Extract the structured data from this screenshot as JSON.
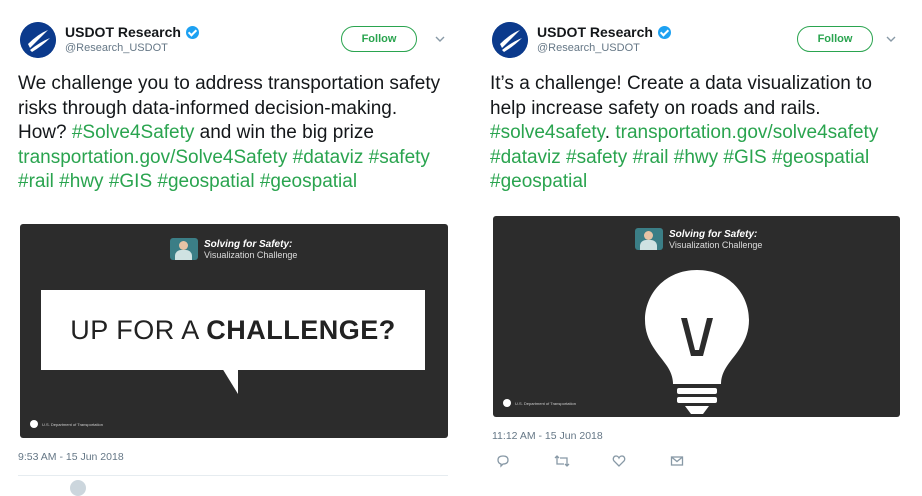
{
  "tweets": [
    {
      "author": "USDOT Research",
      "handle": "@Research_USDOT",
      "follow_label": "Follow",
      "text_plain_1": "We challenge you to address transportation safety risks through data-informed decision-making. How? ",
      "hashtag_solve": "#Solve4Safety",
      "text_plain_2": " and win the big prize ",
      "link": "transportation.gov/Solve4Safety",
      "hashtags_rest": "#dataviz #safety #rail #hwy #GIS #geospatial #geospatial",
      "media": {
        "logo_title": "Solving for Safety:",
        "logo_sub": "Visualization Challenge",
        "headline_light": "UP FOR A ",
        "headline_bold": "CHALLENGE?",
        "footer": "U.S. Department of Transportation"
      },
      "timestamp": "9:53 AM - 15 Jun 2018"
    },
    {
      "author": "USDOT Research",
      "handle": "@Research_USDOT",
      "follow_label": "Follow",
      "text_plain_1": "It’s a challenge! Create a data visualization to help increase safety on roads and rails. ",
      "hashtag_solve": "#solve4safety",
      "text_plain_2": ". ",
      "link": "transportation.gov/solve4safety",
      "hashtags_rest": " #dataviz #safety #rail #hwy #GIS #geospatial #geospatial",
      "media": {
        "logo_title": "Solving for Safety:",
        "logo_sub": "Visualization Challenge",
        "footer": "U.S. Department of Transportation"
      },
      "timestamp": "11:12 AM - 15 Jun 2018"
    }
  ],
  "actions": [
    "reply-icon",
    "retweet-icon",
    "like-icon",
    "message-icon"
  ],
  "colors": {
    "accent": "#2aa44f",
    "verified": "#1da1f2",
    "media_bg": "#2c2c2c",
    "avatar": "#0b3a8c"
  }
}
